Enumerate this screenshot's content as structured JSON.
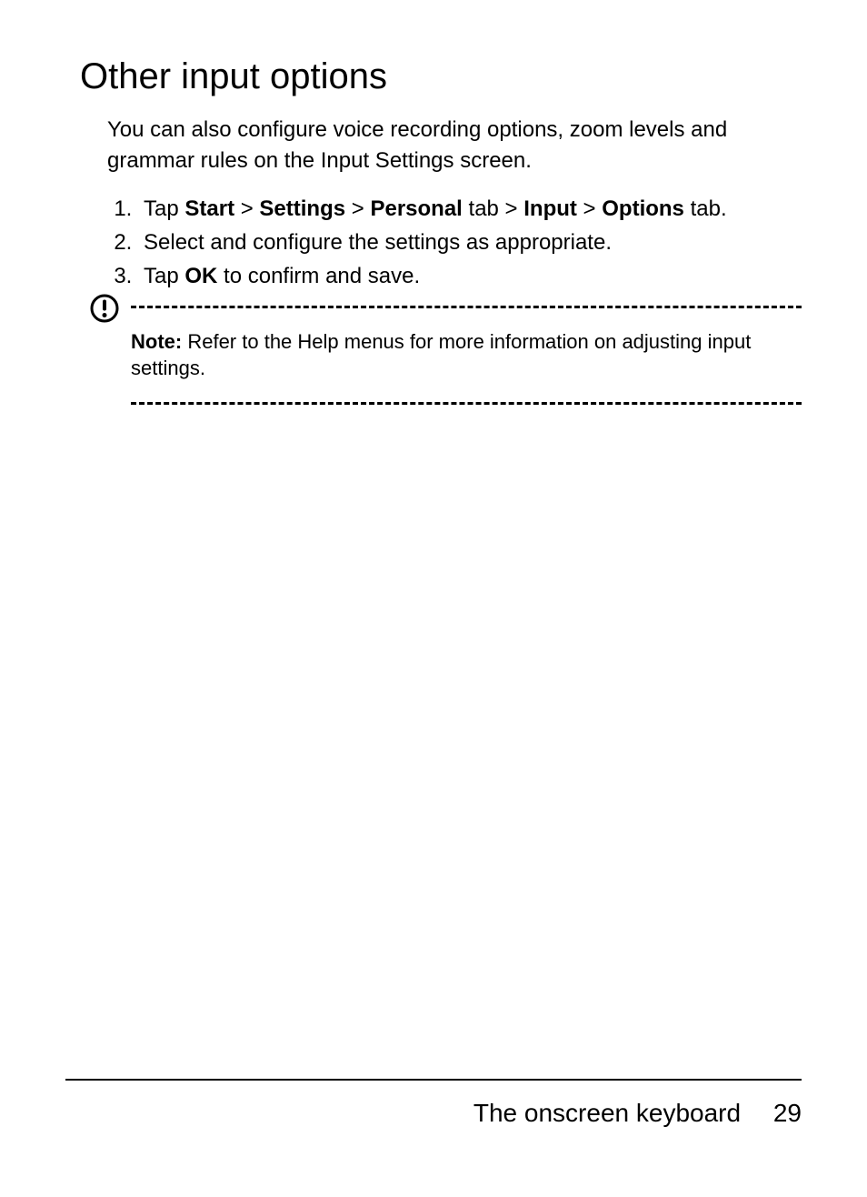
{
  "heading": "Other input options",
  "intro": "You can also configure voice recording options, zoom levels and grammar rules on the Input Settings screen.",
  "steps": {
    "s1": {
      "p1": "Tap ",
      "b1": "Start",
      "p2": " > ",
      "b2": "Settings",
      "p3": " > ",
      "b3": "Personal",
      "p4": " tab > ",
      "b4": "Input",
      "p5": " > ",
      "b5": "Options",
      "p6": " tab."
    },
    "s2": "Select and configure the settings as appropriate.",
    "s3": {
      "p1": "Tap ",
      "b1": "OK",
      "p2": " to confirm and save."
    }
  },
  "note": {
    "label": "Note:",
    "text": " Refer to the Help menus for more information on adjusting input settings."
  },
  "footer": {
    "section": "The onscreen keyboard",
    "page": "29"
  }
}
